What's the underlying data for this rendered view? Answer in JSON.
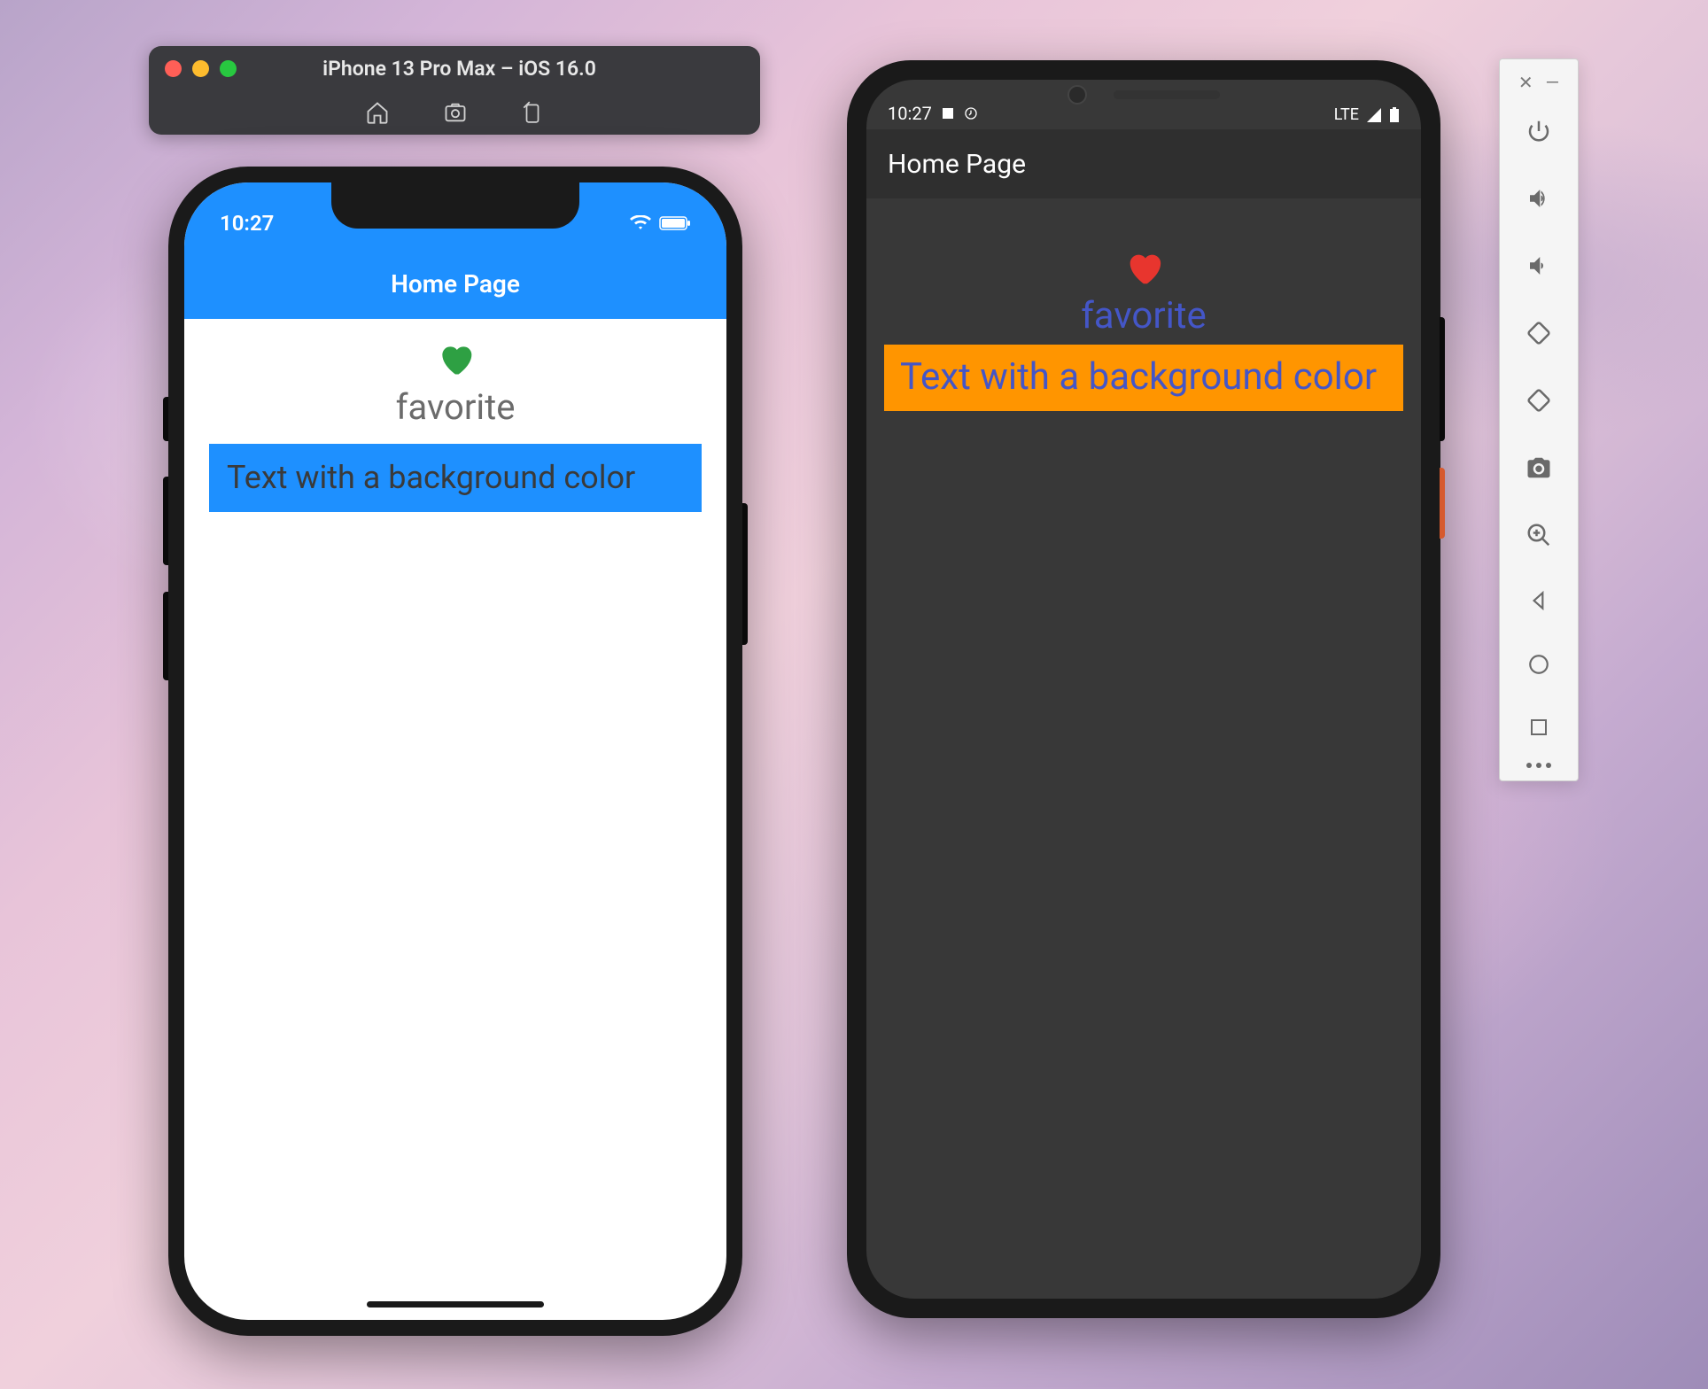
{
  "ios_simulator": {
    "title": "iPhone 13 Pro Max – iOS 16.0",
    "time": "10:27",
    "page_title": "Home Page",
    "favorite_label": "favorite",
    "bg_text": "Text with a background color",
    "colors": {
      "accent": "#1e90ff",
      "heart": "#2ea043",
      "favorite_text": "#6b6b6b"
    }
  },
  "android_emulator": {
    "time": "10:27",
    "network_label": "LTE",
    "page_title": "Home Page",
    "favorite_label": "favorite",
    "bg_text": "Text with a background color",
    "colors": {
      "heart": "#e8352e",
      "favorite_text": "#4456c7",
      "bg_box": "#ff9500"
    }
  },
  "emulator_panel": {
    "icons": [
      "power",
      "volume-up",
      "volume-down",
      "rotate-left",
      "rotate-right",
      "camera",
      "zoom-in",
      "back",
      "home",
      "overview"
    ]
  }
}
